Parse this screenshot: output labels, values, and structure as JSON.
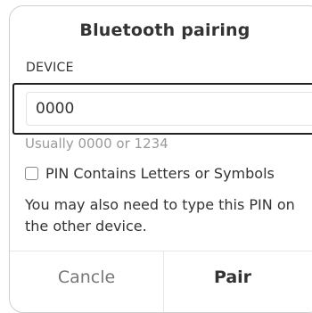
{
  "dialog": {
    "title": "Bluetooth pairing",
    "device_label": "DEVICE",
    "pin_value": "0000",
    "hint": "Usually 0000 or 1234",
    "checkbox_label": "PIN Contains Letters or Symbols",
    "checkbox_checked": false,
    "info": "You may also need to type this PIN on the other device.",
    "cancel_label": "Cancle",
    "pair_label": "Pair"
  }
}
